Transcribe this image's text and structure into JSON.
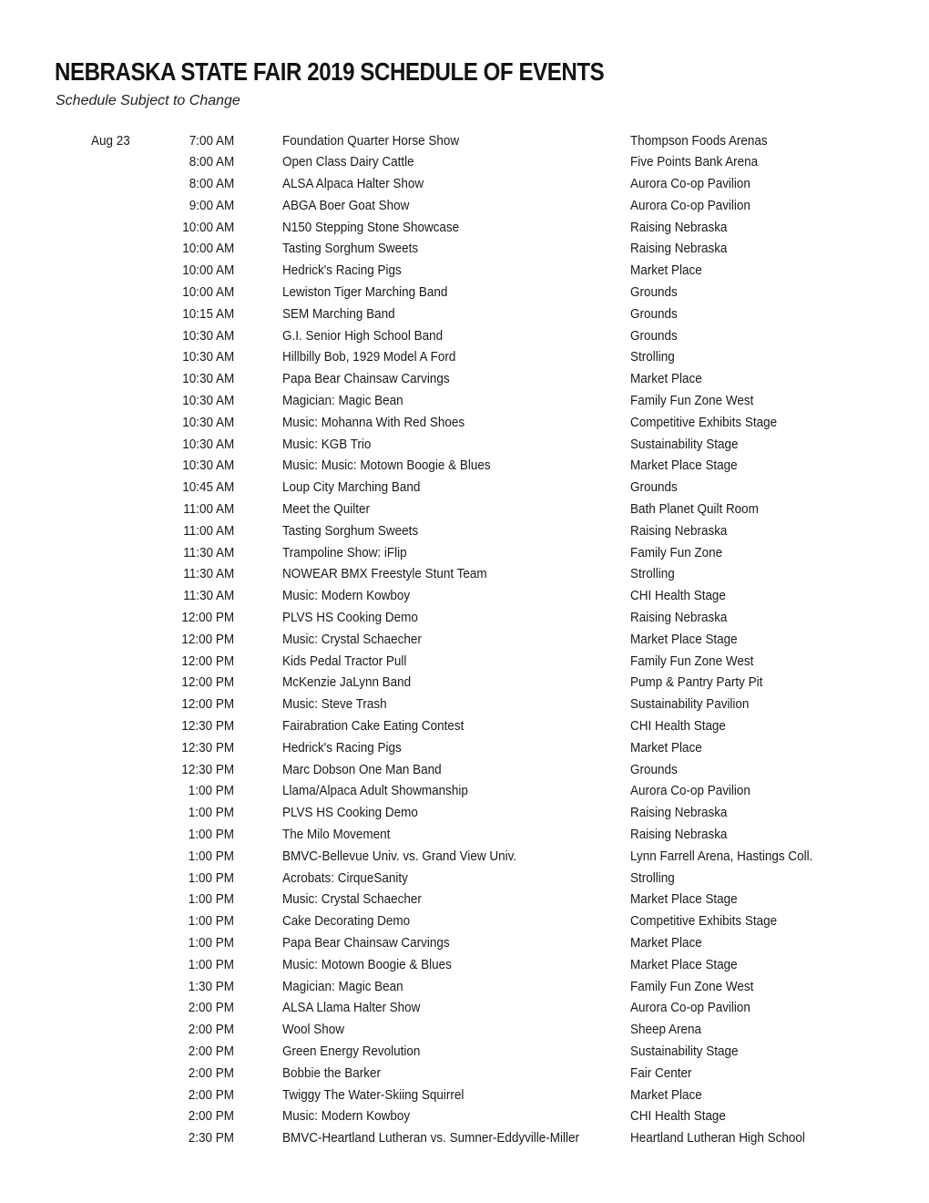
{
  "document": {
    "title": "NEBRASKA STATE FAIR 2019 SCHEDULE OF EVENTS",
    "subtitle": "Schedule Subject to Change"
  },
  "schedule": {
    "date": "Aug 23",
    "rows": [
      {
        "date": "Aug 23",
        "time": "7:00 AM",
        "event": "Foundation Quarter Horse Show",
        "venue": "Thompson Foods Arenas"
      },
      {
        "date": "",
        "time": "8:00 AM",
        "event": "Open Class Dairy Cattle",
        "venue": "Five Points Bank Arena"
      },
      {
        "date": "",
        "time": "8:00 AM",
        "event": "ALSA Alpaca Halter Show",
        "venue": "Aurora Co-op Pavilion"
      },
      {
        "date": "",
        "time": "9:00 AM",
        "event": "ABGA Boer Goat Show",
        "venue": "Aurora Co-op Pavilion"
      },
      {
        "date": "",
        "time": "10:00 AM",
        "event": "N150 Stepping Stone Showcase",
        "venue": "Raising Nebraska"
      },
      {
        "date": "",
        "time": "10:00 AM",
        "event": "Tasting Sorghum Sweets",
        "venue": "Raising Nebraska"
      },
      {
        "date": "",
        "time": "10:00 AM",
        "event": "Hedrick's Racing Pigs",
        "venue": "Market Place"
      },
      {
        "date": "",
        "time": "10:00 AM",
        "event": "Lewiston Tiger Marching Band",
        "venue": "Grounds"
      },
      {
        "date": "",
        "time": "10:15 AM",
        "event": "SEM Marching Band",
        "venue": "Grounds"
      },
      {
        "date": "",
        "time": "10:30 AM",
        "event": "G.I. Senior High School Band",
        "venue": "Grounds"
      },
      {
        "date": "",
        "time": "10:30 AM",
        "event": "Hillbilly Bob, 1929 Model A Ford",
        "venue": "Strolling"
      },
      {
        "date": "",
        "time": "10:30 AM",
        "event": "Papa Bear Chainsaw Carvings",
        "venue": "Market Place"
      },
      {
        "date": "",
        "time": "10:30 AM",
        "event": "Magician: Magic Bean",
        "venue": "Family Fun Zone West"
      },
      {
        "date": "",
        "time": "10:30 AM",
        "event": "Music: Mohanna With Red Shoes",
        "venue": "Competitive Exhibits Stage"
      },
      {
        "date": "",
        "time": "10:30 AM",
        "event": "Music: KGB Trio",
        "venue": "Sustainability Stage"
      },
      {
        "date": "",
        "time": "10:30 AM",
        "event": "Music: Music: Motown Boogie & Blues",
        "venue": "Market Place Stage"
      },
      {
        "date": "",
        "time": "10:45 AM",
        "event": "Loup City Marching Band",
        "venue": "Grounds"
      },
      {
        "date": "",
        "time": "11:00 AM",
        "event": "Meet the Quilter",
        "venue": "Bath Planet Quilt Room"
      },
      {
        "date": "",
        "time": "11:00 AM",
        "event": "Tasting Sorghum Sweets",
        "venue": "Raising Nebraska"
      },
      {
        "date": "",
        "time": "11:30 AM",
        "event": "Trampoline Show: iFlip",
        "venue": "Family Fun Zone"
      },
      {
        "date": "",
        "time": "11:30 AM",
        "event": "NOWEAR BMX Freestyle Stunt Team",
        "venue": "Strolling"
      },
      {
        "date": "",
        "time": "11:30 AM",
        "event": "Music: Modern Kowboy",
        "venue": "CHI Health Stage"
      },
      {
        "date": "",
        "time": "12:00 PM",
        "event": "PLVS HS Cooking Demo",
        "venue": "Raising Nebraska"
      },
      {
        "date": "",
        "time": "12:00 PM",
        "event": "Music: Crystal Schaecher",
        "venue": "Market Place Stage"
      },
      {
        "date": "",
        "time": "12:00 PM",
        "event": "Kids Pedal Tractor Pull",
        "venue": "Family Fun Zone West"
      },
      {
        "date": "",
        "time": "12:00 PM",
        "event": "McKenzie JaLynn Band",
        "venue": "Pump & Pantry Party Pit"
      },
      {
        "date": "",
        "time": "12:00 PM",
        "event": "Music: Steve Trash",
        "venue": "Sustainability Pavilion"
      },
      {
        "date": "",
        "time": "12:30 PM",
        "event": "Fairabration Cake Eating Contest",
        "venue": "CHI Health Stage"
      },
      {
        "date": "",
        "time": "12:30 PM",
        "event": "Hedrick's Racing Pigs",
        "venue": "Market Place"
      },
      {
        "date": "",
        "time": "12:30 PM",
        "event": "Marc Dobson One Man Band",
        "venue": "Grounds"
      },
      {
        "date": "",
        "time": "1:00 PM",
        "event": "Llama/Alpaca Adult Showmanship",
        "venue": "Aurora Co-op Pavilion"
      },
      {
        "date": "",
        "time": "1:00 PM",
        "event": "PLVS HS Cooking Demo",
        "venue": "Raising Nebraska"
      },
      {
        "date": "",
        "time": "1:00 PM",
        "event": "The Milo Movement",
        "venue": "Raising Nebraska"
      },
      {
        "date": "",
        "time": "1:00 PM",
        "event": "BMVC-Bellevue Univ. vs. Grand View Univ.",
        "venue": "Lynn Farrell Arena, Hastings Coll."
      },
      {
        "date": "",
        "time": "1:00 PM",
        "event": "Acrobats: CirqueSanity",
        "venue": "Strolling"
      },
      {
        "date": "",
        "time": "1:00 PM",
        "event": "Music: Crystal Schaecher",
        "venue": "Market Place Stage"
      },
      {
        "date": "",
        "time": "1:00 PM",
        "event": "Cake Decorating Demo",
        "venue": "Competitive Exhibits Stage"
      },
      {
        "date": "",
        "time": "1:00 PM",
        "event": "Papa Bear Chainsaw Carvings",
        "venue": "Market Place"
      },
      {
        "date": "",
        "time": "1:00 PM",
        "event": "Music: Motown Boogie & Blues",
        "venue": "Market Place Stage"
      },
      {
        "date": "",
        "time": "1:30 PM",
        "event": "Magician: Magic Bean",
        "venue": "Family Fun Zone West"
      },
      {
        "date": "",
        "time": "2:00 PM",
        "event": "ALSA Llama Halter Show",
        "venue": "Aurora Co-op Pavilion"
      },
      {
        "date": "",
        "time": "2:00 PM",
        "event": "Wool Show",
        "venue": "Sheep Arena"
      },
      {
        "date": "",
        "time": "2:00 PM",
        "event": "Green Energy Revolution",
        "venue": "Sustainability Stage"
      },
      {
        "date": "",
        "time": "2:00 PM",
        "event": "Bobbie the Barker",
        "venue": "Fair Center"
      },
      {
        "date": "",
        "time": "2:00 PM",
        "event": "Twiggy The Water-Skiing Squirrel",
        "venue": "Market Place"
      },
      {
        "date": "",
        "time": "2:00 PM",
        "event": "Music: Modern Kowboy",
        "venue": "CHI Health Stage"
      },
      {
        "date": "",
        "time": "2:30 PM",
        "event": "BMVC-Heartland Lutheran vs. Sumner-Eddyville-Miller",
        "venue": "Heartland Lutheran High School"
      }
    ]
  }
}
